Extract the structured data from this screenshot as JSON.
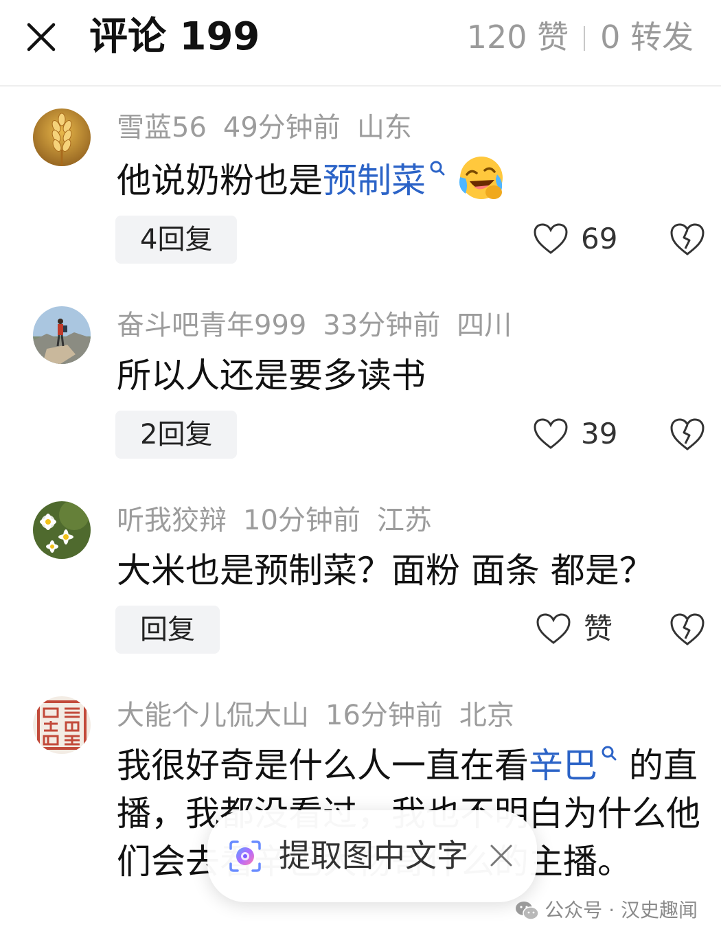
{
  "header": {
    "title": "评论 199",
    "likes": "120 赞",
    "reposts": "0 转发",
    "close_icon": "close-icon"
  },
  "comments": [
    {
      "username": "雪蓝56",
      "time": "49分钟前",
      "location": "山东",
      "text_before": "他说奶粉也是",
      "link": "预制菜",
      "text_after": "",
      "emoji": "crying-laughing-emoji",
      "reply": "4回复",
      "likes": "69"
    },
    {
      "username": "奋斗吧青年999",
      "time": "33分钟前",
      "location": "四川",
      "text": "所以人还是要多读书",
      "reply": "2回复",
      "likes": "39"
    },
    {
      "username": "听我狡辩",
      "time": "10分钟前",
      "location": "江苏",
      "text": "大米也是预制菜？面粉 面条 都是？",
      "reply": "回复",
      "likes": "赞"
    },
    {
      "username": "大能个儿侃大山",
      "time": "16分钟前",
      "location": "北京",
      "text_before": "我很好奇是什么人一直在看",
      "link": "辛巴",
      "text_after": "的直播，我都没看过，我也不明白为什么他们会去看辛巴大杨哥什么的主播。"
    }
  ],
  "extract_popup": {
    "label": "提取图中文字",
    "icon": "lens-icon"
  },
  "watermark": {
    "text": "公众号 · 汉史趣闻",
    "icon": "wechat-icon"
  },
  "colors": {
    "link": "#2b63c7",
    "meta": "#9c9c9c",
    "reply_bg": "#f2f3f5"
  }
}
